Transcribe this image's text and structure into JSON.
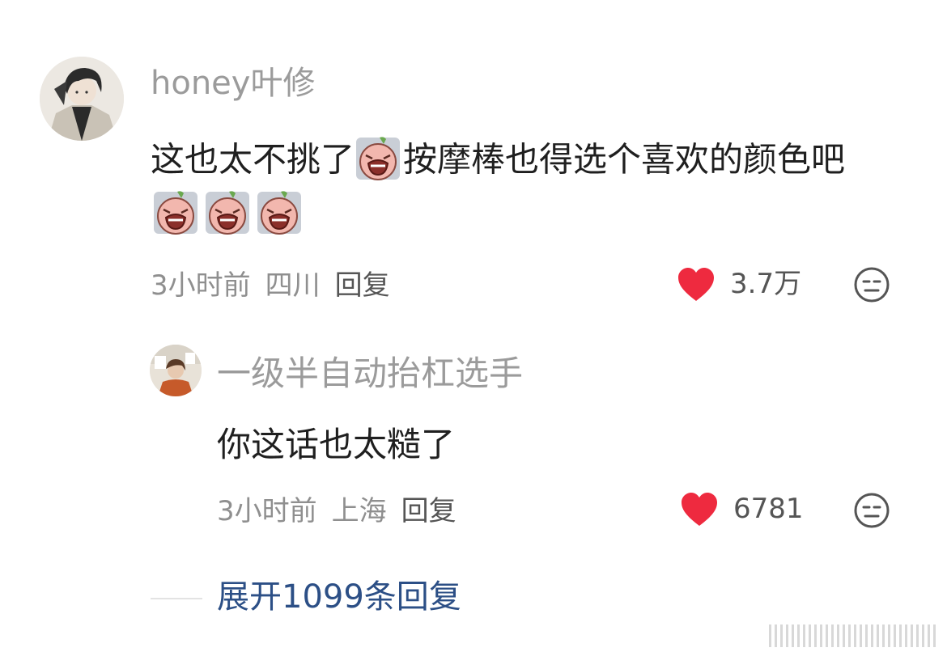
{
  "comment": {
    "username": "honey叶修",
    "text_part1": "这也太不挑了",
    "text_part2": "按摩棒也得选个喜欢的颜色吧",
    "emoji_icon": "crying-face-emoji",
    "time": "3小时前",
    "location": "四川",
    "reply_label": "回复",
    "like_count": "3.7万"
  },
  "reply": {
    "username": "一级半自动抬杠选手",
    "text": "你这话也太糙了",
    "time": "3小时前",
    "location": "上海",
    "reply_label": "回复",
    "like_count": "6781"
  },
  "expand": {
    "label": "展开1099条回复"
  },
  "colors": {
    "heart": "#ee2a3f",
    "link": "#2c4f86",
    "muted": "#9b9b9b"
  }
}
